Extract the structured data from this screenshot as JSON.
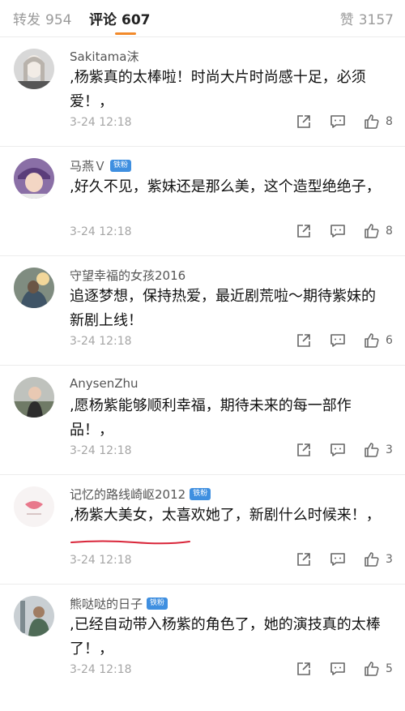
{
  "tabs": {
    "repost_label": "转发",
    "repost_count": "954",
    "comment_label": "评论",
    "comment_count": "607",
    "like_label": "赞",
    "like_count": "3157"
  },
  "colors": {
    "tab_underline": "#f28a2a",
    "badge": "#3f8fe0",
    "underline_annotation": "#d9263a"
  },
  "comments": [
    {
      "user": "Sakitama沫",
      "badge": "",
      "text": ",杨紫真的太棒啦！时尚大片时尚感十足，必须爱！，",
      "time": "3-24 12:18",
      "likes": "8"
    },
    {
      "user": "马燕Ｖ",
      "badge": "铁粉",
      "text": ",好久不见，紫妹还是那么美，这个造型绝绝子，",
      "time": "3-24 12:18",
      "likes": "8"
    },
    {
      "user": "守望幸福的女孩2016",
      "badge": "",
      "text": "追逐梦想，保持热爱，最近剧荒啦～期待紫妹的新剧上线！",
      "time": "3-24 12:18",
      "likes": "6"
    },
    {
      "user": "AnysenZhu",
      "badge": "",
      "text": ",愿杨紫能够顺利幸福，期待未来的每一部作品！，",
      "time": "3-24 12:18",
      "likes": "3"
    },
    {
      "user": "记忆的路线崎岖2012",
      "badge": "铁粉",
      "text": ",杨紫大美女，太喜欢她了，新剧什么时候来！，",
      "time": "3-24 12:18",
      "likes": "3"
    },
    {
      "user": "熊哒哒的日子",
      "badge": "铁粉",
      "text": ",已经自动带入杨紫的角色了，她的演技真的太棒了！，",
      "time": "3-24 12:18",
      "likes": "5"
    }
  ]
}
